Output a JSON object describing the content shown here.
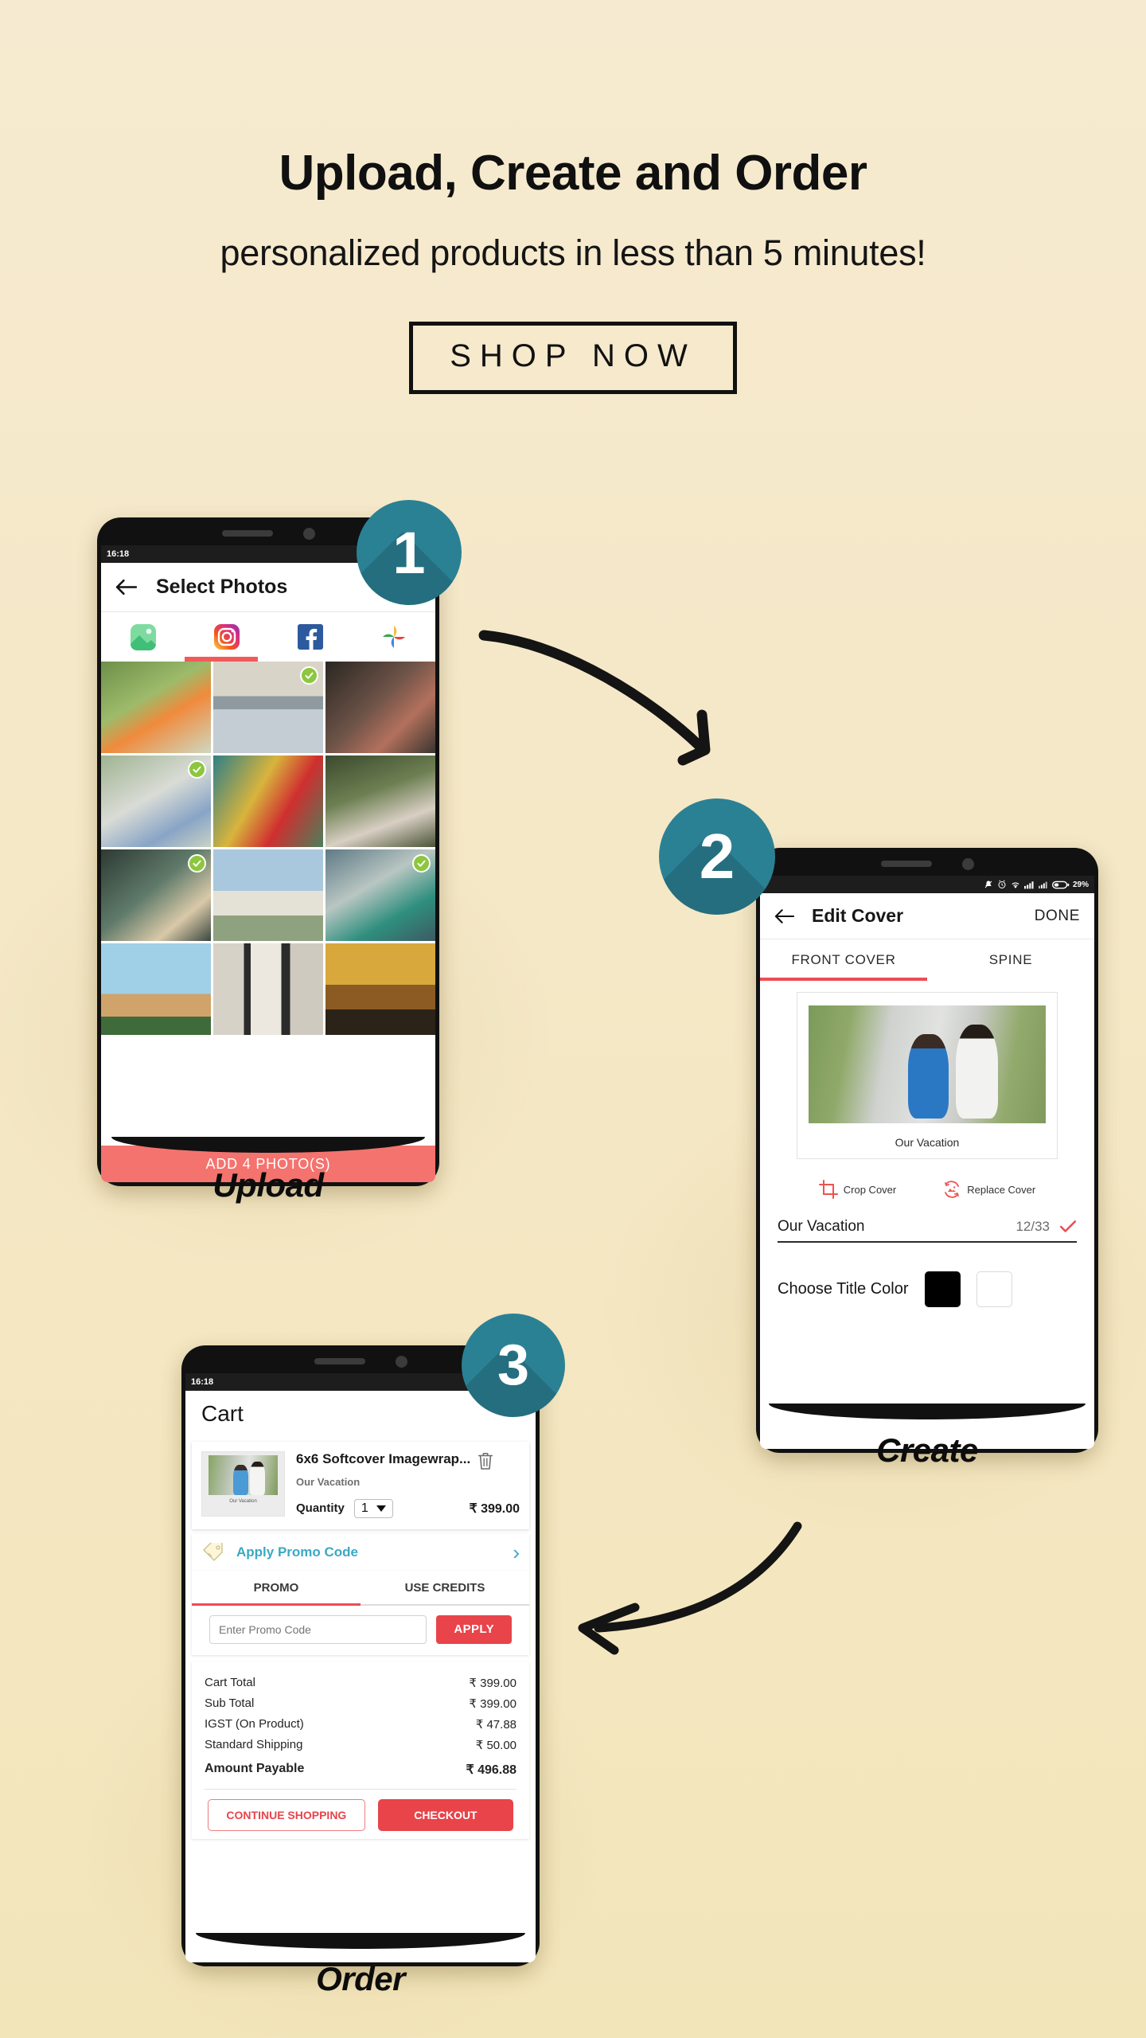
{
  "hero": {
    "title": "Upload, Create and Order",
    "subtitle": "personalized products in less than 5 minutes!",
    "cta_label": "SHOP NOW"
  },
  "theme": {
    "background": "#f4e8c1",
    "badge_teal": "#2b8194",
    "accent_red": "#e8444a",
    "coral": "#f4736f",
    "promo_link": "#3aa9c4",
    "check_green": "#8dc63f"
  },
  "steps": [
    {
      "number": "1",
      "label": "Upload"
    },
    {
      "number": "2",
      "label": "Create"
    },
    {
      "number": "3",
      "label": "Order"
    }
  ],
  "phone1": {
    "status": {
      "time": "16:18",
      "icons": [
        "mute-icon",
        "alarm-icon",
        "wifi-icon",
        "signal-icon"
      ]
    },
    "appbar": {
      "back_icon": "back-arrow-icon",
      "title": "Select Photos"
    },
    "source_tabs": [
      {
        "name": "gallery-tab",
        "icon": "gallery-icon",
        "active": false
      },
      {
        "name": "instagram-tab",
        "icon": "instagram-icon",
        "active": true
      },
      {
        "name": "facebook-tab",
        "icon": "facebook-icon",
        "active": false
      },
      {
        "name": "google-photos-tab",
        "icon": "google-photos-icon",
        "active": false
      }
    ],
    "photos": [
      {
        "selected": false
      },
      {
        "selected": true
      },
      {
        "selected": false
      },
      {
        "selected": true
      },
      {
        "selected": false
      },
      {
        "selected": false
      },
      {
        "selected": true
      },
      {
        "selected": false
      },
      {
        "selected": true
      },
      {
        "selected": false
      },
      {
        "selected": false
      },
      {
        "selected": false
      }
    ],
    "add_button_label": "ADD 4 PHOTO(S)"
  },
  "phone2": {
    "status": {
      "icons": [
        "mute-icon",
        "alarm-icon",
        "wifi-icon",
        "signal-icon",
        "signal2-icon",
        "battery-icon"
      ],
      "battery": "29%"
    },
    "appbar": {
      "back_icon": "back-arrow-icon",
      "title": "Edit Cover",
      "done_label": "DONE"
    },
    "tabs": [
      {
        "label": "FRONT COVER",
        "active": true
      },
      {
        "label": "SPINE",
        "active": false
      }
    ],
    "cover": {
      "caption": "Our Vacation"
    },
    "actions": [
      {
        "label": "Crop Cover",
        "icon": "crop-icon"
      },
      {
        "label": "Replace Cover",
        "icon": "replace-image-icon"
      }
    ],
    "title_field": {
      "value": "Our Vacation",
      "counter": "12/33",
      "confirm_icon": "check-icon"
    },
    "color_picker": {
      "label": "Choose Title Color",
      "swatches": [
        "#000000",
        "#ffffff"
      ]
    }
  },
  "phone3": {
    "status": {
      "time": "16:18",
      "icons": [
        "wifi-icon",
        "signal-icon",
        "signal-off-icon",
        "battery-icon"
      ]
    },
    "appbar": {
      "title": "Cart"
    },
    "item": {
      "title": "6x6 Softcover  Imagewrap...",
      "subtitle": "Our Vacation",
      "thumb_caption": "Our Vacation",
      "quantity_label": "Quantity",
      "quantity_value": "1",
      "price": "₹ 399.00",
      "delete_icon": "trash-icon"
    },
    "promo_bar": {
      "label": "Apply Promo Code",
      "icon": "promo-tag-icon",
      "chevron": "chevron-right-icon"
    },
    "promo_tabs": [
      {
        "label": "PROMO",
        "active": true
      },
      {
        "label": "USE CREDITS",
        "active": false
      }
    ],
    "promo_form": {
      "input_value": "",
      "input_placeholder": "Enter Promo Code",
      "apply_label": "APPLY"
    },
    "totals": [
      {
        "label": "Cart Total",
        "value": "₹ 399.00",
        "bold": false
      },
      {
        "label": "Sub Total",
        "value": "₹ 399.00",
        "bold": false
      },
      {
        "label": "IGST (On Product)",
        "value": "₹ 47.88",
        "bold": false
      },
      {
        "label": "Standard Shipping",
        "value": "₹ 50.00",
        "bold": false
      },
      {
        "label": "Amount Payable",
        "value": "₹ 496.88",
        "bold": true
      }
    ],
    "cta": {
      "continue_label": "CONTINUE SHOPPING",
      "checkout_label": "CHECKOUT"
    }
  }
}
